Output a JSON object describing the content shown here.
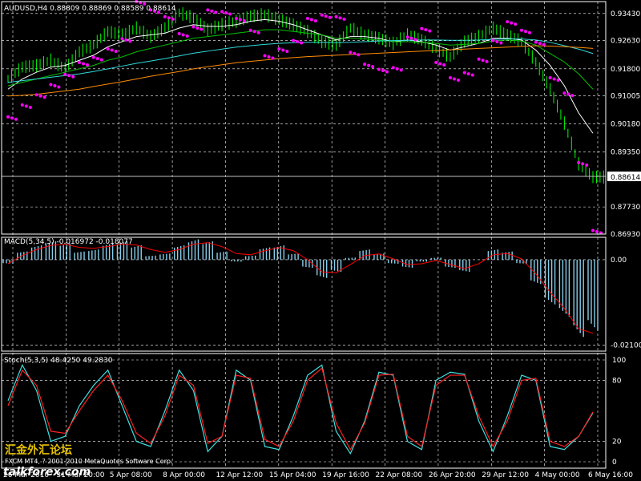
{
  "colors": {
    "background": "#000000",
    "grid": "#ffffff",
    "frame": "#ffffff",
    "bull_candle": "#00ff00",
    "psar": "#ff00ff",
    "ma_fast": "#ffffff",
    "ma_mid": "#00c000",
    "ma_slow": "#30d8d8",
    "ma_long": "#ff8c00",
    "macd_hist": "#87ceeb",
    "macd_signal": "#ff0000",
    "stoch_main": "#40e0e0",
    "stoch_signal": "#ff2020",
    "last_price_line": "#c0c0c0",
    "watermark": "#ffd700"
  },
  "price_panel": {
    "header": "AUDUSD,H4  0.88809 0.88869 0.88589 0.88614",
    "last_price_label": "0.88614",
    "y_ticks": [
      "0.93430",
      "0.92630",
      "0.91800",
      "0.91005",
      "0.90180",
      "0.89350",
      "0.87730",
      "0.86930"
    ]
  },
  "macd_panel": {
    "header": "MACD(5,34,5) -0.016972 -0.018077",
    "y_ticks": [
      "0.00",
      "-0.02100"
    ]
  },
  "stoch_panel": {
    "header": "Stoch(5,3,5) 48.4250 49.2830",
    "y_ticks": [
      "100",
      "80",
      "20",
      "0"
    ]
  },
  "x_ticks": [
    "26 Mar 2010",
    "31 Mar 20:00",
    "5 Apr 08:00",
    "8 Apr 00:00",
    "12 Apr 12:00",
    "15 Apr 04:00",
    "19 Apr 16:00",
    "22 Apr 08:00",
    "26 Apr 20:00",
    "29 Apr 12:00",
    "4 May 00:00",
    "6 May 16:00"
  ],
  "footer": {
    "copyright": "FXCM MT4, ? 2001-2010 MetaQuotes Software Corp.",
    "watermark_text": "汇金外汇论坛",
    "watermark_site": "talkforex.com"
  },
  "chart_data": {
    "type": "line",
    "symbol": "AUDUSD",
    "timeframe": "H4",
    "ylim": [
      0.8693,
      0.9378
    ],
    "x_categories": [
      "26 Mar 2010",
      "31 Mar 20:00",
      "5 Apr 08:00",
      "8 Apr 00:00",
      "12 Apr 12:00",
      "15 Apr 04:00",
      "19 Apr 16:00",
      "22 Apr 08:00",
      "26 Apr 20:00",
      "29 Apr 12:00",
      "4 May 00:00",
      "6 May 16:00"
    ],
    "series": [
      {
        "values": [
          0.915,
          0.9185,
          0.919,
          0.9205,
          0.918,
          0.923,
          0.925,
          0.929,
          0.928,
          0.93,
          0.9275,
          0.93,
          0.9345,
          0.933,
          0.9295,
          0.931,
          0.932,
          0.9335,
          0.934,
          0.9325,
          0.931,
          0.929,
          0.926,
          0.925,
          0.93,
          0.928,
          0.927,
          0.9255,
          0.928,
          0.9265,
          0.924,
          0.9215,
          0.926,
          0.9275,
          0.93,
          0.928,
          0.926,
          0.92,
          0.912,
          0.902,
          0.89,
          0.8861
        ]
      },
      {
        "values": [
          0.912,
          0.915,
          0.917,
          0.9185,
          0.919,
          0.9205,
          0.922,
          0.9245,
          0.926,
          0.9275,
          0.928,
          0.9285,
          0.93,
          0.931,
          0.9305,
          0.9305,
          0.931,
          0.932,
          0.9325,
          0.932,
          0.931,
          0.9295,
          0.928,
          0.9265,
          0.9275,
          0.9275,
          0.927,
          0.926,
          0.9265,
          0.926,
          0.925,
          0.9235,
          0.9245,
          0.9255,
          0.927,
          0.927,
          0.9265,
          0.9235,
          0.919,
          0.913,
          0.905,
          0.899
        ]
      },
      {
        "values": [
          0.913,
          0.914,
          0.915,
          0.916,
          0.917,
          0.918,
          0.919,
          0.9205,
          0.9215,
          0.923,
          0.924,
          0.925,
          0.926,
          0.927,
          0.9275,
          0.928,
          0.9285,
          0.929,
          0.9295,
          0.9295,
          0.929,
          0.9285,
          0.928,
          0.927,
          0.927,
          0.9268,
          0.9265,
          0.926,
          0.926,
          0.9258,
          0.9255,
          0.925,
          0.9252,
          0.9255,
          0.9262,
          0.9265,
          0.9262,
          0.925,
          0.9225,
          0.92,
          0.9165,
          0.912
        ]
      },
      {
        "values": [
          0.914,
          0.9145,
          0.915,
          0.9155,
          0.916,
          0.9165,
          0.9172,
          0.918,
          0.9188,
          0.9196,
          0.9203,
          0.921,
          0.9218,
          0.9226,
          0.9232,
          0.9238,
          0.9244,
          0.9248,
          0.9252,
          0.9255,
          0.9257,
          0.9258,
          0.9258,
          0.9257,
          0.9258,
          0.926,
          0.9262,
          0.9263,
          0.9264,
          0.9265,
          0.9265,
          0.9264,
          0.9264,
          0.9265,
          0.9267,
          0.9268,
          0.9268,
          0.9265,
          0.9258,
          0.9248,
          0.9238,
          0.9225
        ]
      },
      {
        "values": [
          0.91,
          0.9102,
          0.9105,
          0.911,
          0.9115,
          0.912,
          0.9128,
          0.9135,
          0.9142,
          0.915,
          0.9158,
          0.9165,
          0.9172,
          0.918,
          0.9186,
          0.9192,
          0.9198,
          0.9202,
          0.9206,
          0.921,
          0.9213,
          0.9216,
          0.9218,
          0.922,
          0.9222,
          0.9224,
          0.9226,
          0.9228,
          0.923,
          0.9232,
          0.9234,
          0.9236,
          0.9238,
          0.924,
          0.9242,
          0.9244,
          0.9246,
          0.9248,
          0.9247,
          0.9245,
          0.9243,
          0.924
        ]
      }
    ],
    "psar_values": [
      0.9035,
      0.907,
      0.91,
      0.913,
      0.916,
      0.9195,
      0.921,
      0.9235,
      0.9265,
      0.9375,
      0.935,
      0.933,
      0.928,
      0.93,
      0.935,
      0.9345,
      0.9325,
      0.929,
      0.9215,
      0.9235,
      0.926,
      0.9325,
      0.9335,
      0.933,
      0.9225,
      0.919,
      0.9175,
      0.918,
      0.927,
      0.9295,
      0.9195,
      0.915,
      0.9165,
      0.9205,
      0.926,
      0.9315,
      0.929,
      0.9255,
      0.915,
      0.9105,
      0.89,
      0.87
    ],
    "macd": {
      "name": "MACD(5,34,5)",
      "ylim": [
        -0.0225,
        0.0055
      ],
      "hist": [
        -0.001,
        0.002,
        0.0035,
        0.0045,
        0.004,
        0.002,
        0.0025,
        0.004,
        0.0045,
        0.0035,
        0.001,
        0.0015,
        0.0035,
        0.005,
        0.0045,
        0.002,
        -0.0005,
        0.001,
        0.003,
        0.0035,
        0.0015,
        -0.002,
        -0.0045,
        -0.003,
        0.0005,
        0.0025,
        0.0015,
        -0.001,
        -0.002,
        -0.0005,
        0.0005,
        -0.002,
        -0.003,
        0.0,
        0.0025,
        0.002,
        -0.001,
        -0.006,
        -0.011,
        -0.014,
        -0.019,
        -0.0175
      ],
      "signal": [
        -0.001,
        0.001,
        0.0025,
        0.0035,
        0.0038,
        0.003,
        0.0028,
        0.0032,
        0.0038,
        0.0036,
        0.0025,
        0.0018,
        0.0025,
        0.0038,
        0.0042,
        0.0032,
        0.0015,
        0.0012,
        0.0022,
        0.003,
        0.0022,
        0.0,
        -0.003,
        -0.0032,
        -0.0012,
        0.001,
        0.0014,
        0.0002,
        -0.0012,
        -0.001,
        -0.0002,
        -0.0012,
        -0.0022,
        -0.001,
        0.0012,
        0.0015,
        0.0002,
        -0.0035,
        -0.008,
        -0.012,
        -0.017,
        -0.0181
      ]
    },
    "stochastic": {
      "name": "Stoch(5,3,5)",
      "ylim": [
        0,
        100
      ],
      "main": [
        60,
        95,
        70,
        20,
        25,
        55,
        75,
        90,
        55,
        20,
        15,
        50,
        90,
        70,
        10,
        25,
        90,
        80,
        15,
        12,
        45,
        85,
        95,
        30,
        8,
        40,
        88,
        85,
        20,
        12,
        80,
        88,
        86,
        40,
        10,
        45,
        85,
        80,
        15,
        12,
        25,
        48
      ],
      "signal": [
        55,
        90,
        75,
        30,
        28,
        50,
        70,
        85,
        60,
        28,
        18,
        45,
        85,
        75,
        18,
        25,
        85,
        82,
        22,
        15,
        40,
        80,
        92,
        38,
        12,
        38,
        85,
        86,
        25,
        15,
        75,
        85,
        85,
        45,
        15,
        40,
        80,
        82,
        20,
        15,
        25,
        49
      ]
    }
  }
}
